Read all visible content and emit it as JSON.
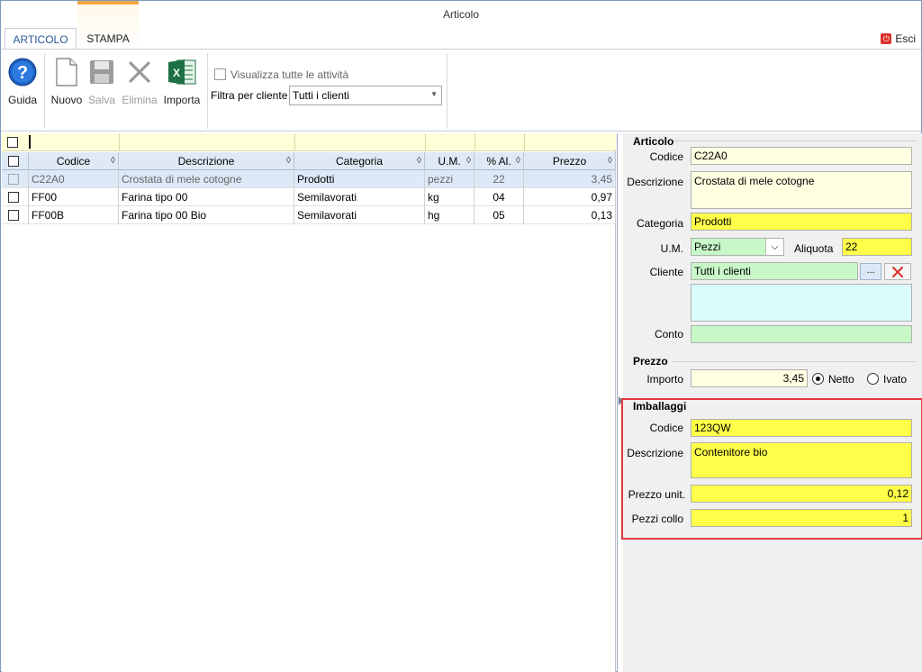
{
  "window": {
    "title": "Articolo"
  },
  "tabs": [
    {
      "label": "ARTICOLO"
    },
    {
      "label": "STAMPA"
    }
  ],
  "esci_label": "Esci",
  "toolbar": {
    "guida": "Guida",
    "nuovo": "Nuovo",
    "salva": "Salva",
    "elimina": "Elimina",
    "importa": "Importa",
    "show_all_label": "Visualizza tutte le attività",
    "filter_label": "Filtra per cliente",
    "filter_value": "Tutti i clienti"
  },
  "grid": {
    "headers": {
      "codice": "Codice",
      "descrizione": "Descrizione",
      "categoria": "Categoria",
      "um": "U.M.",
      "al": "% Al.",
      "prezzo": "Prezzo"
    },
    "rows": [
      {
        "codice": "C22A0",
        "descrizione": "Crostata di mele cotogne",
        "categoria": "Prodotti",
        "um": "pezzi",
        "al": "22",
        "prezzo": "3,45"
      },
      {
        "codice": "FF00",
        "descrizione": "Farina tipo 00",
        "categoria": "Semilavorati",
        "um": "kg",
        "al": "04",
        "prezzo": "0,97"
      },
      {
        "codice": "FF00B",
        "descrizione": "Farina tipo 00 Bio",
        "categoria": "Semilavorati",
        "um": "hg",
        "al": "05",
        "prezzo": "0,13"
      }
    ]
  },
  "articolo": {
    "title": "Articolo",
    "codice_label": "Codice",
    "codice": "C22A0",
    "descrizione_label": "Descrizione",
    "descrizione": "Crostata di mele cotogne",
    "categoria_label": "Categoria",
    "categoria": "Prodotti",
    "um_label": "U.M.",
    "um": "Pezzi",
    "aliquota_label": "Aliquota",
    "aliquota": "22",
    "cliente_label": "Cliente",
    "cliente": "Tutti i clienti",
    "cliente_browse": "...",
    "conto_label": "Conto",
    "conto": ""
  },
  "prezzo": {
    "title": "Prezzo",
    "importo_label": "Importo",
    "importo": "3,45",
    "netto_label": "Netto",
    "ivato_label": "Ivato"
  },
  "imballaggi": {
    "title": "Imballaggi",
    "codice_label": "Codice",
    "codice": "123QW",
    "descrizione_label": "Descrizione",
    "descrizione": "Contenitore bio",
    "prezzo_label": "Prezzo unit.",
    "prezzo": "0,12",
    "pezzi_label": "Pezzi collo",
    "pezzi": "1"
  }
}
